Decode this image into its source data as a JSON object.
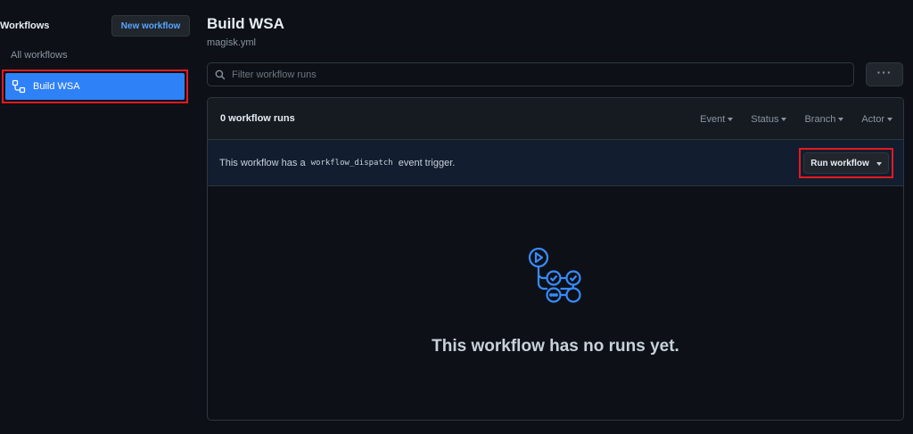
{
  "sidebar": {
    "title": "Workflows",
    "new_workflow_label": "New workflow",
    "all_workflows_label": "All workflows",
    "items": [
      {
        "label": "Build WSA",
        "icon": "workflow-icon",
        "active": true
      }
    ]
  },
  "main": {
    "title": "Build WSA",
    "subtitle": "magisk.yml",
    "filter": {
      "placeholder": "Filter workflow runs",
      "value": ""
    },
    "more_label": "···",
    "runs": {
      "count_label": "0 workflow runs",
      "filters": [
        {
          "label": "Event"
        },
        {
          "label": "Status"
        },
        {
          "label": "Branch"
        },
        {
          "label": "Actor"
        }
      ]
    },
    "dispatch": {
      "text_before": "This workflow has a",
      "code": "workflow_dispatch",
      "text_after": "event trigger.",
      "run_button_label": "Run workflow"
    },
    "empty_state": {
      "icon": "actions-workflow-icon",
      "message": "This workflow has no runs yet."
    }
  },
  "colors": {
    "background": "#0d1117",
    "accent": "#2f81f7",
    "highlight_outline": "#e5191e"
  }
}
